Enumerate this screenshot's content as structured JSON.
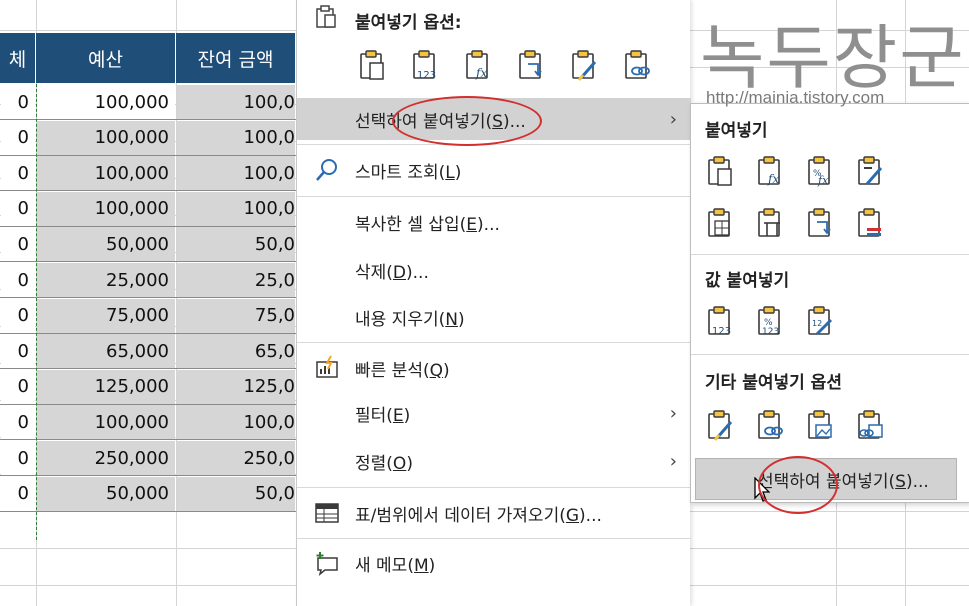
{
  "sheet": {
    "headers": [
      "체",
      "예산",
      "잔여 금액"
    ],
    "rows": [
      {
        "a": "0",
        "budget": "100,000",
        "remain": "100,0"
      },
      {
        "a": "0",
        "budget": "100,000",
        "remain": "100,0"
      },
      {
        "a": "0",
        "budget": "100,000",
        "remain": "100,0"
      },
      {
        "a": "0",
        "budget": "100,000",
        "remain": "100,0"
      },
      {
        "a": "0",
        "budget": "50,000",
        "remain": "50,0"
      },
      {
        "a": "0",
        "budget": "25,000",
        "remain": "25,0"
      },
      {
        "a": "0",
        "budget": "75,000",
        "remain": "75,0"
      },
      {
        "a": "0",
        "budget": "65,000",
        "remain": "65,0"
      },
      {
        "a": "0",
        "budget": "125,000",
        "remain": "125,0"
      },
      {
        "a": "0",
        "budget": "100,000",
        "remain": "100,0"
      },
      {
        "a": "0",
        "budget": "250,000",
        "remain": "250,0"
      },
      {
        "a": "0",
        "budget": "50,000",
        "remain": "50,0"
      }
    ],
    "header_color": "#1f4e79",
    "selection_color": "#d6d6d6"
  },
  "menu": {
    "paste_options_title": "붙여넣기 옵션:",
    "paste_icons": [
      "paste-icon",
      "paste-values-icon",
      "paste-formulas-icon",
      "paste-transpose-icon",
      "paste-formatting-icon",
      "paste-link-icon"
    ],
    "items": [
      {
        "pre": "선택하여 붙여넣기(",
        "key": "S",
        "post": ")...",
        "icon": "",
        "submenu": true,
        "highlighted": true
      },
      {
        "pre": "스마트 조회(",
        "key": "L",
        "post": ")",
        "icon": "search-icon",
        "submenu": false
      },
      {
        "pre": "복사한 셀 삽입(",
        "key": "E",
        "post": ")...",
        "icon": "",
        "submenu": false
      },
      {
        "pre": "삭제(",
        "key": "D",
        "post": ")...",
        "icon": "",
        "submenu": false
      },
      {
        "pre": "내용 지우기(",
        "key": "N",
        "post": ")",
        "icon": "",
        "submenu": false
      },
      {
        "pre": "빠른 분석(",
        "key": "Q",
        "post": ")",
        "icon": "quick-analysis-icon",
        "submenu": false
      },
      {
        "pre": "필터(",
        "key": "E",
        "post": ")",
        "icon": "",
        "submenu": true
      },
      {
        "pre": "정렬(",
        "key": "O",
        "post": ")",
        "icon": "",
        "submenu": true
      },
      {
        "pre": "표/범위에서 데이터 가져오기(",
        "key": "G",
        "post": ")...",
        "icon": "table-icon",
        "submenu": false
      },
      {
        "pre": "새 메모(",
        "key": "M",
        "post": ")",
        "icon": "new-comment-icon",
        "submenu": false
      }
    ],
    "submenu_arrow": "›"
  },
  "submenu": {
    "paste_title": "붙여넣기",
    "paste_icons_row1": [
      "paste-icon",
      "paste-formulas-icon",
      "paste-formulas-number-format-icon",
      "paste-keep-source-format-icon"
    ],
    "paste_icons_row2": [
      "paste-no-borders-icon",
      "paste-keep-column-width-icon",
      "paste-transpose-icon",
      "paste-merge-format-icon"
    ],
    "values_title": "값 붙여넣기",
    "values_icons": [
      "paste-values-icon",
      "paste-values-number-format-icon",
      "paste-values-source-format-icon"
    ],
    "other_title": "기타 붙여넣기 옵션",
    "other_icons": [
      "paste-formatting-icon",
      "paste-link-icon",
      "paste-picture-icon",
      "paste-linked-picture-icon"
    ],
    "special_pre": "선택하여 붙여넣기(",
    "special_key": "S",
    "special_post": ")..."
  },
  "watermark": {
    "title": "녹두장군",
    "url": "http://mainia.tistory.com"
  },
  "accent_color": "#d32f2f"
}
